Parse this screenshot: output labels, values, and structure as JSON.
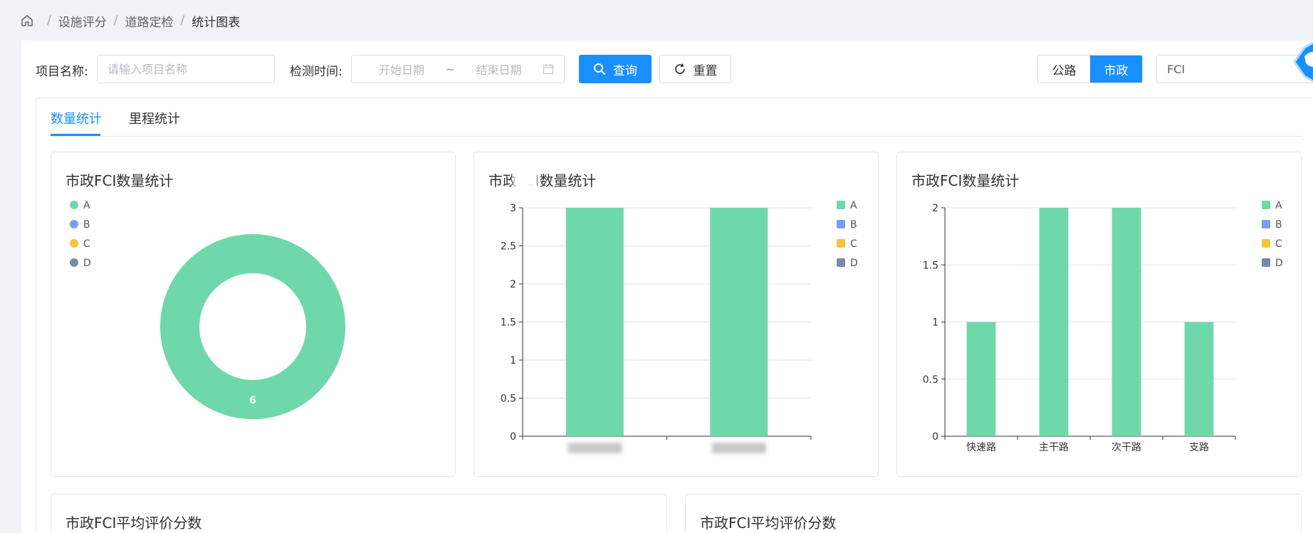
{
  "breadcrumb": [
    "设施评分",
    "道路定检",
    "统计图表"
  ],
  "filters": {
    "project_label": "项目名称:",
    "project_placeholder": "请输入项目名称",
    "time_label": "检测时间:",
    "start_placeholder": "开始日期",
    "range_sep": "~",
    "end_placeholder": "结束日期",
    "query_label": "查询",
    "reset_label": "重置"
  },
  "toggle": {
    "options": [
      "公路",
      "市政"
    ],
    "active": "市政"
  },
  "index_select": {
    "value": "FCI"
  },
  "tabs": [
    {
      "label": "数量统计",
      "active": true
    },
    {
      "label": "里程统计",
      "active": false
    }
  ],
  "colors": {
    "primary": "#1890ff",
    "A": "#6fd8ab",
    "B": "#7b9ef0",
    "C": "#f5c33b",
    "D": "#778aa8"
  },
  "legend": [
    "A",
    "B",
    "C",
    "D"
  ],
  "cards": {
    "donut_title": "市政FCI数量统计",
    "bar1_title": "市政FCI数量统计",
    "bar2_title": "市政FCI数量统计",
    "avg1_title": "市政FCI平均评价分数",
    "avg2_title": "市政FCI平均评价分数"
  },
  "chart_data": [
    {
      "type": "pie",
      "title": "市政FCI数量统计",
      "slices": [
        {
          "name": "A",
          "value": 6
        },
        {
          "name": "B",
          "value": 0
        },
        {
          "name": "C",
          "value": 0
        },
        {
          "name": "D",
          "value": 0
        }
      ],
      "legend_position": "top-left",
      "donut": true
    },
    {
      "type": "bar",
      "title": "市政FCI数量统计",
      "categories": [
        "",
        ""
      ],
      "series": [
        {
          "name": "A",
          "values": [
            3,
            3
          ]
        }
      ],
      "yticks": [
        "0",
        "0.5",
        "1",
        "1.5",
        "2",
        "2.5",
        "3"
      ],
      "ylim": [
        0,
        3
      ],
      "grid": true,
      "legend_position": "right"
    },
    {
      "type": "bar",
      "title": "市政FCI数量统计",
      "categories": [
        "快速路",
        "主干路",
        "次干路",
        "支路"
      ],
      "series": [
        {
          "name": "A",
          "values": [
            1,
            2,
            2,
            1
          ]
        }
      ],
      "yticks": [
        "0",
        "0.5",
        "1",
        "1.5",
        "2"
      ],
      "ylim": [
        0,
        2
      ],
      "grid": true,
      "legend_position": "right"
    }
  ]
}
